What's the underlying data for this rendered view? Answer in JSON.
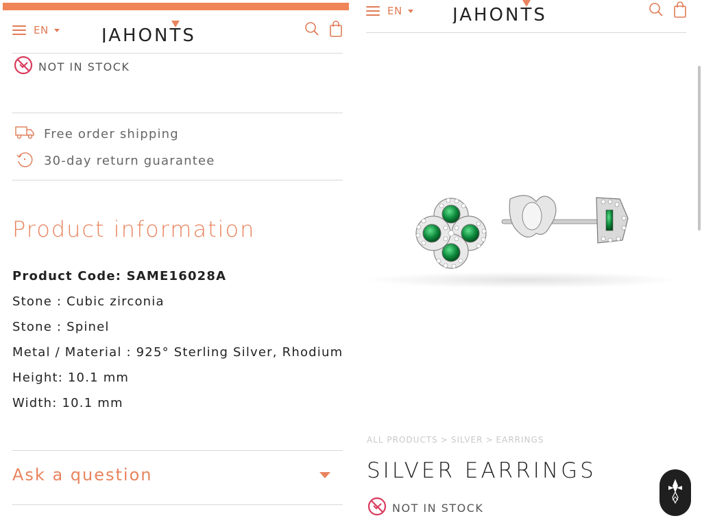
{
  "brand": {
    "logo_text": "JAHONTS",
    "accent_color": "#f08658",
    "title_color": "#e8845e"
  },
  "header": {
    "language": "EN"
  },
  "stock": {
    "status": "NOT IN STOCK"
  },
  "benefits": [
    {
      "icon": "truck-icon",
      "label": "Free order shipping"
    },
    {
      "icon": "return-icon",
      "label": "30-day return guarantee"
    }
  ],
  "product_info": {
    "title": "Product information",
    "product_code": "Product Code: SAME16028A",
    "specs": [
      "Stone : Cubic zirconia",
      "Stone : Spinel",
      "Metal / Material : 925° Sterling Silver, Rhodium",
      "Height: 10.1 mm",
      "Width: 10.1 mm"
    ]
  },
  "ask_question": {
    "label": "Ask a question"
  },
  "breadcrumb": {
    "items": [
      "ALL PRODUCTS",
      "SILVER",
      "EARRINGS"
    ],
    "separator": ">"
  },
  "product": {
    "name": "SILVER EARRINGS"
  }
}
